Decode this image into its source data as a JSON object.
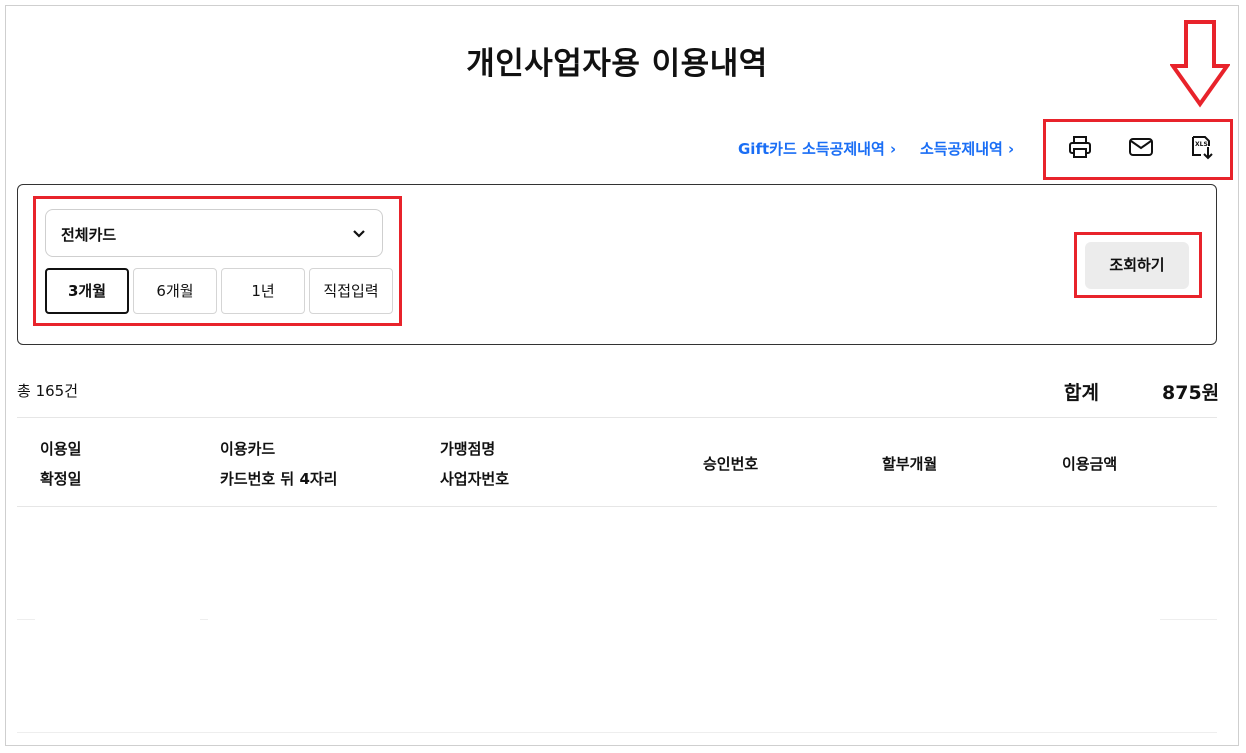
{
  "page": {
    "title": "개인사업자용 이용내역"
  },
  "links": {
    "gift_card": "Gift카드 소득공제내역 ›",
    "income_deduction": "소득공제내역 ›"
  },
  "icons": [
    "print-icon",
    "mail-icon",
    "excel-download-icon"
  ],
  "filter": {
    "card_select": "전체카드",
    "periods": [
      "3개월",
      "6개월",
      "1년",
      "직접입력"
    ],
    "active_period": "3개월",
    "search_label": "조회하기"
  },
  "summary": {
    "count": "총 165건",
    "total_label": "합계",
    "total_value": "875원"
  },
  "table": {
    "headers": {
      "use_date": "이용일",
      "confirm_date": "확정일",
      "card": "이용카드",
      "card_last4": "카드번호 뒤 4자리",
      "merchant": "가맹점명",
      "biz_no": "사업자번호",
      "approval": "승인번호",
      "installment": "할부개월",
      "amount": "이용금액"
    }
  },
  "colors": {
    "accent_link": "#1a6ef5",
    "annotation_red": "#e8232b"
  }
}
